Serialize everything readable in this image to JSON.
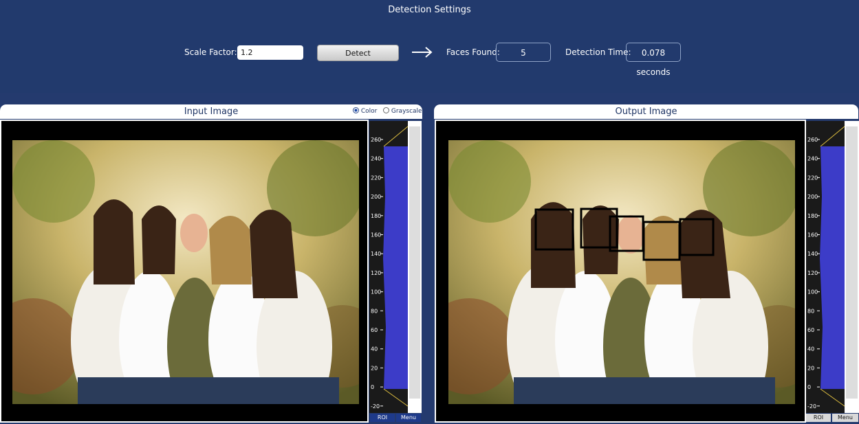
{
  "header": {
    "title": "Detection Settings",
    "scale_factor_label": "Scale Factor:",
    "scale_factor_value": "1.2",
    "detect_label": "Detect",
    "faces_found_label": "Faces Found:",
    "faces_found_value": "5",
    "detection_time_label": "Detection Time:",
    "detection_time_value": "0.078 seconds"
  },
  "input_panel": {
    "title": "Input Image",
    "color_option": "Color",
    "grayscale_option": "Grayscale",
    "selected_mode": "Color",
    "roi_label": "ROI",
    "menu_label": "Menu"
  },
  "output_panel": {
    "title": "Output Image",
    "roi_label": "ROI",
    "menu_label": "Menu"
  },
  "histogram": {
    "ticks": [
      "260",
      "240",
      "220",
      "200",
      "180",
      "160",
      "140",
      "120",
      "100",
      "80",
      "60",
      "40",
      "20",
      "0",
      "-20"
    ],
    "fill_color": "#3c3cc8"
  },
  "colors": {
    "background": "#243a6e",
    "panel_heading": "#1e3464"
  }
}
